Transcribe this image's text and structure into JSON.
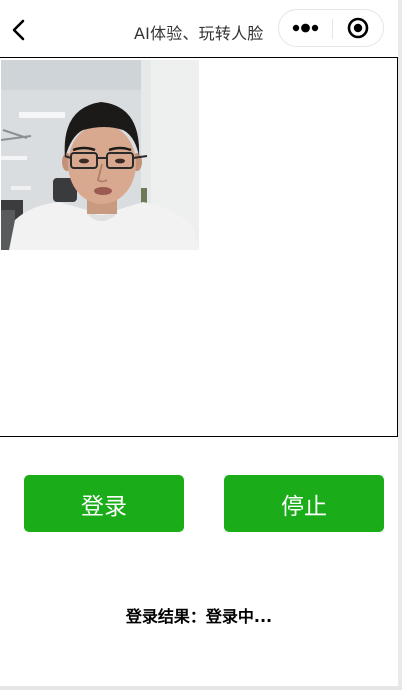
{
  "navbar": {
    "title": "AI体验、玩转人脸",
    "back_icon": "chevron-left-icon",
    "more_icon": "more-dots-icon",
    "close_icon": "record-circle-icon"
  },
  "camera": {
    "subject": "camera preview with person wearing glasses"
  },
  "buttons": {
    "login_label": "登录",
    "stop_label": "停止",
    "accent_color": "#1aad19"
  },
  "result": {
    "label": "登录结果：",
    "value": "登录中..."
  }
}
